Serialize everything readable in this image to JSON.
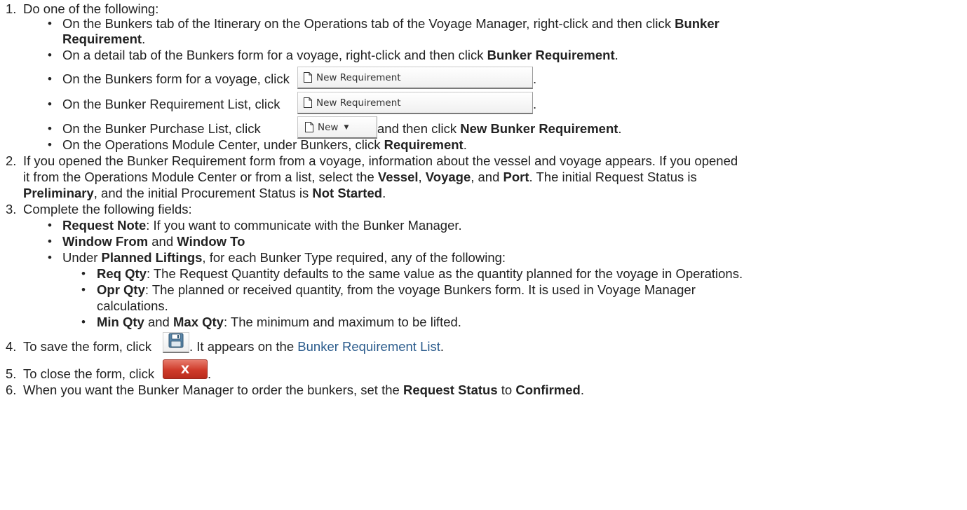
{
  "step1": {
    "number": "1.",
    "text": "Do one of the following:",
    "b1": {
      "pre": "On the Bunkers tab of the Itinerary on the Operations tab of the Voyage Manager, right-click and then click ",
      "bold1": "Bunker",
      "bold2": "Requirement",
      "post": "."
    },
    "b2": {
      "pre": "On a detail tab of the Bunkers form for a voyage, right-click and then click ",
      "bold": "Bunker Requirement",
      "post": "."
    },
    "b3": {
      "pre": "On the Bunkers form for a voyage, click",
      "post": "."
    },
    "b4": {
      "pre": "On the Bunker Requirement List, click",
      "post": "."
    },
    "b5": {
      "pre": "On the Bunker Purchase List, click",
      "mid": " and then click ",
      "bold": "New Bunker Requirement",
      "post": "."
    },
    "b6": {
      "pre": "On the Operations Module Center, under Bunkers, click ",
      "bold": "Requirement",
      "post": "."
    }
  },
  "buttons": {
    "new_requirement": "New Requirement",
    "new": "New",
    "close_glyph": "X"
  },
  "step2": {
    "number": "2.",
    "l1": "If you opened the Bunker Requirement form from a voyage, information about the vessel and voyage appears. If you opened",
    "l2": {
      "pre": "it from the Operations Module Center or from a list, select the ",
      "b1": "Vessel",
      "s1": ", ",
      "b2": "Voyage",
      "s2": ", and ",
      "b3": "Port",
      "post": ". The initial Request Status is"
    },
    "l3": {
      "b1": "Preliminary",
      "mid": ", and the initial Procurement Status is ",
      "b2": "Not Started",
      "post": "."
    }
  },
  "step3": {
    "number": "3.",
    "text": "Complete the following fields:",
    "b1": {
      "bold": "Request Note",
      "post": ": If you want to communicate with the Bunker Manager."
    },
    "b2": {
      "bold1": "Window From",
      "mid": " and ",
      "bold2": "Window To"
    },
    "b3": {
      "pre": "Under ",
      "bold": "Planned Liftings",
      "post": ", for each Bunker Type required, any of the following:"
    },
    "s1": {
      "bold": "Req Qty",
      "post": ": The Request Quantity defaults to the same value as the quantity planned for the voyage in Operations."
    },
    "s2": {
      "bold": "Opr Qty",
      "post": ": The planned or received quantity, from the voyage Bunkers form. It is used in Voyage Manager",
      "cont": "calculations."
    },
    "s3": {
      "bold1": "Min Qty",
      "mid": " and ",
      "bold2": "Max Qty",
      "post": ": The minimum and maximum to be lifted."
    }
  },
  "step4": {
    "number": "4.",
    "pre": "To save the form, click",
    "mid": ". It appears on the ",
    "link": "Bunker Requirement List",
    "post": "."
  },
  "step5": {
    "number": "5.",
    "pre": "To close the form, click",
    "post": "."
  },
  "step6": {
    "number": "6.",
    "pre": "When you want the Bunker Manager to order the bunkers, set the ",
    "b1": "Request Status",
    "mid": " to ",
    "b2": "Confirmed",
    "post": "."
  }
}
